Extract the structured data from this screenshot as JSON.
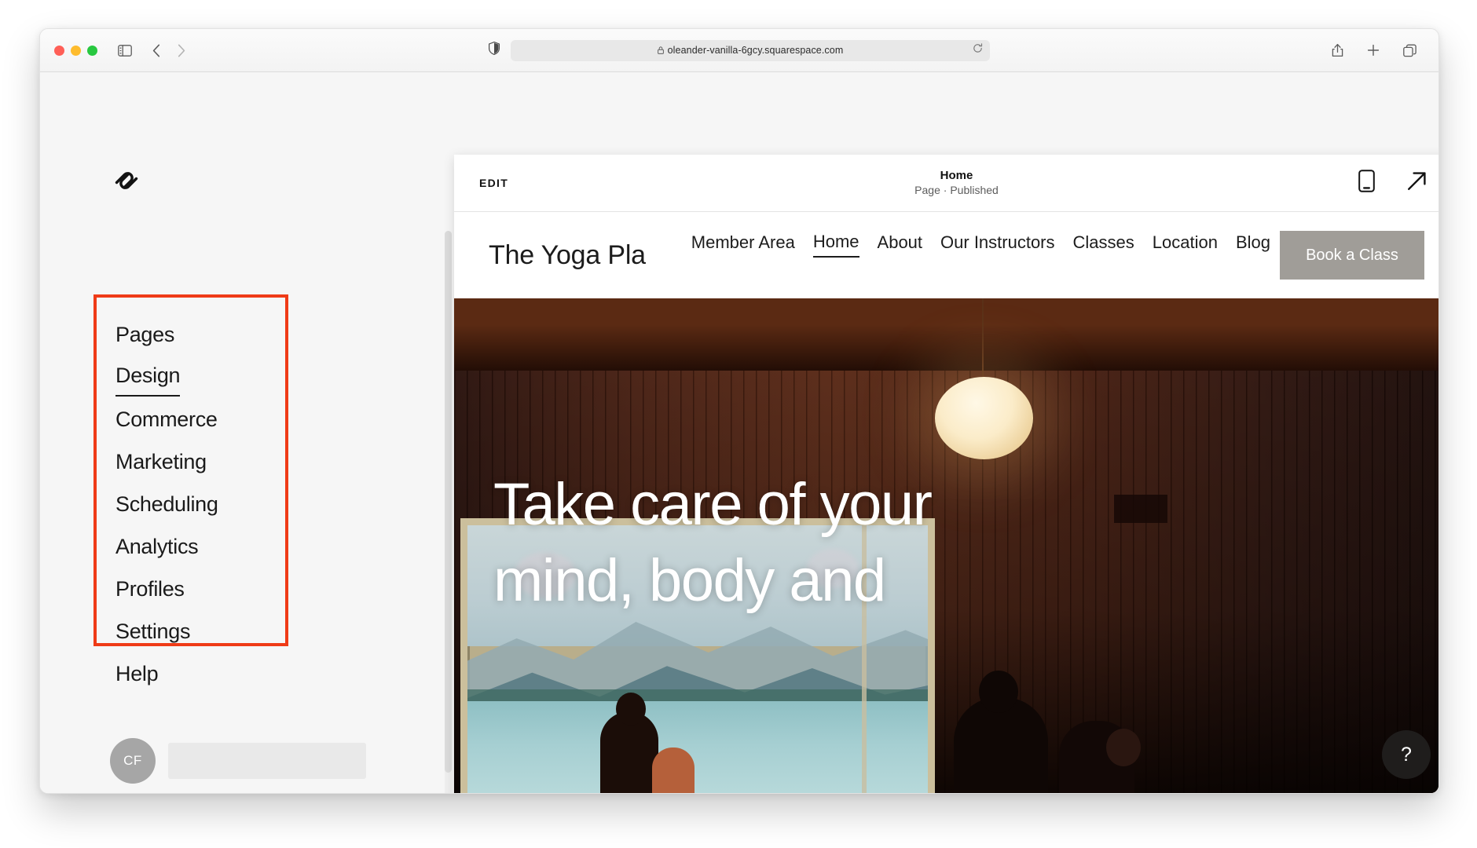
{
  "browser": {
    "traffic_lights": [
      "close",
      "minimize",
      "maximize"
    ],
    "address": "oleander-vanilla-6gcy.squarespace.com",
    "icons": {
      "sidebar": "sidebar-toggle-icon",
      "back": "back-arrow-icon",
      "forward": "forward-arrow-icon",
      "shield": "privacy-shield-icon",
      "lock": "lock-icon",
      "reload": "reload-icon",
      "share": "share-icon",
      "new_tab": "plus-icon",
      "tabs": "tab-overview-icon"
    }
  },
  "admin": {
    "logo_name": "squarespace-logo",
    "nav_items": [
      {
        "label": "Pages",
        "active": false
      },
      {
        "label": "Design",
        "active": true
      },
      {
        "label": "Commerce",
        "active": false
      },
      {
        "label": "Marketing",
        "active": false
      },
      {
        "label": "Scheduling",
        "active": false
      },
      {
        "label": "Analytics",
        "active": false
      },
      {
        "label": "Profiles",
        "active": false
      },
      {
        "label": "Settings",
        "active": false
      },
      {
        "label": "Help",
        "active": false
      }
    ],
    "highlight_color": "#ef3b17",
    "account": {
      "initials": "CF"
    }
  },
  "preview_bar": {
    "edit_label": "EDIT",
    "page_title": "Home",
    "page_status": "Page · Published",
    "mobile_icon": "mobile-preview-icon",
    "open_icon": "open-external-icon"
  },
  "site": {
    "title": "The Yoga Pla",
    "nav": [
      {
        "label": "Member Area",
        "active": false
      },
      {
        "label": "Home",
        "active": true
      },
      {
        "label": "About",
        "active": false
      },
      {
        "label": "Our Instructors",
        "active": false
      },
      {
        "label": "Classes",
        "active": false
      },
      {
        "label": "Location",
        "active": false
      },
      {
        "label": "Blog",
        "active": false
      }
    ],
    "cta_label": "Book a Class",
    "cta_color": "#a09d98",
    "hero_heading": "Take care of your mind, body and",
    "help_label": "?"
  }
}
